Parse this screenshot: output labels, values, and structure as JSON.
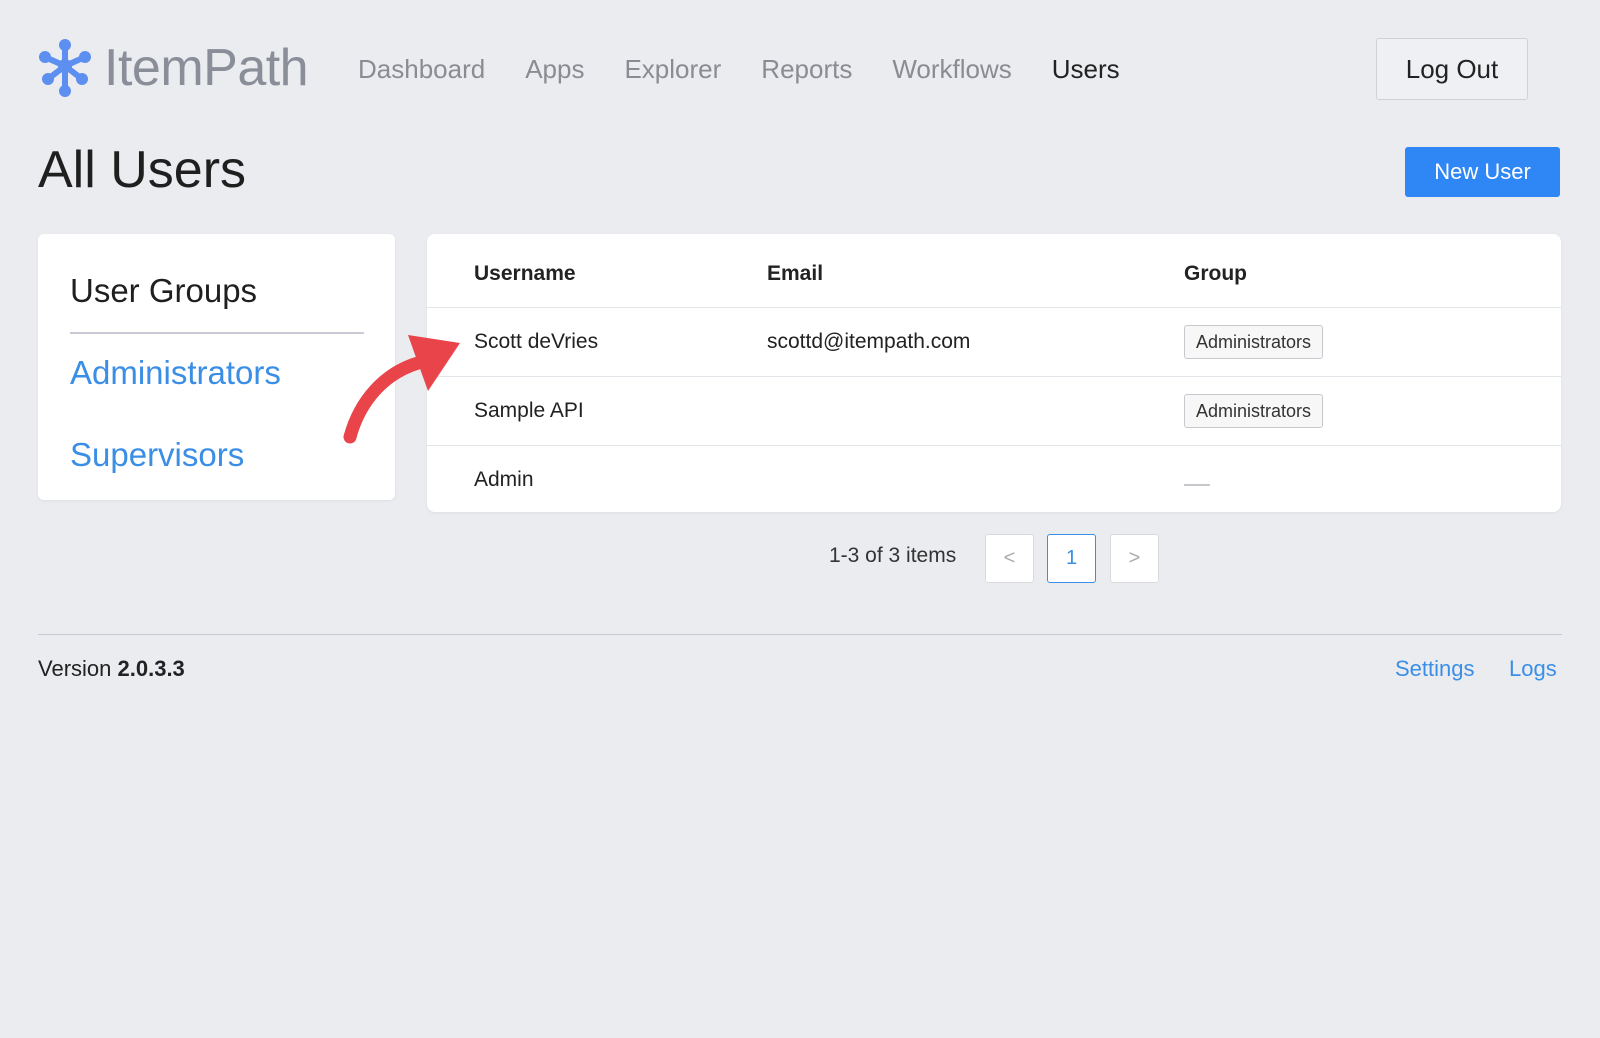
{
  "header": {
    "logo_text": "ItemPath",
    "nav": [
      "Dashboard",
      "Apps",
      "Explorer",
      "Reports",
      "Workflows",
      "Users"
    ],
    "active_nav": "Users",
    "logout_label": "Log Out"
  },
  "page": {
    "title": "All Users",
    "new_user_label": "New User"
  },
  "groups": {
    "title": "User Groups",
    "items": [
      "Administrators",
      "Supervisors"
    ]
  },
  "table": {
    "columns": [
      "Username",
      "Email",
      "Group"
    ],
    "rows": [
      {
        "username": "Scott deVries",
        "email": "scottd@itempath.com",
        "group": "Administrators"
      },
      {
        "username": "Sample API",
        "email": "",
        "group": "Administrators"
      },
      {
        "username": "Admin",
        "email": "",
        "group": ""
      }
    ]
  },
  "pagination": {
    "summary": "1-3 of 3 items",
    "prev": "<",
    "current": "1",
    "next": ">"
  },
  "footer": {
    "version_label": "Version",
    "version": "2.0.3.3",
    "links": [
      "Settings",
      "Logs"
    ]
  },
  "colors": {
    "accent": "#2f86f5",
    "link": "#3a8ee6",
    "logo": "#5d8ff0",
    "annotation_arrow": "#e8444a",
    "background": "#ebecf0"
  }
}
